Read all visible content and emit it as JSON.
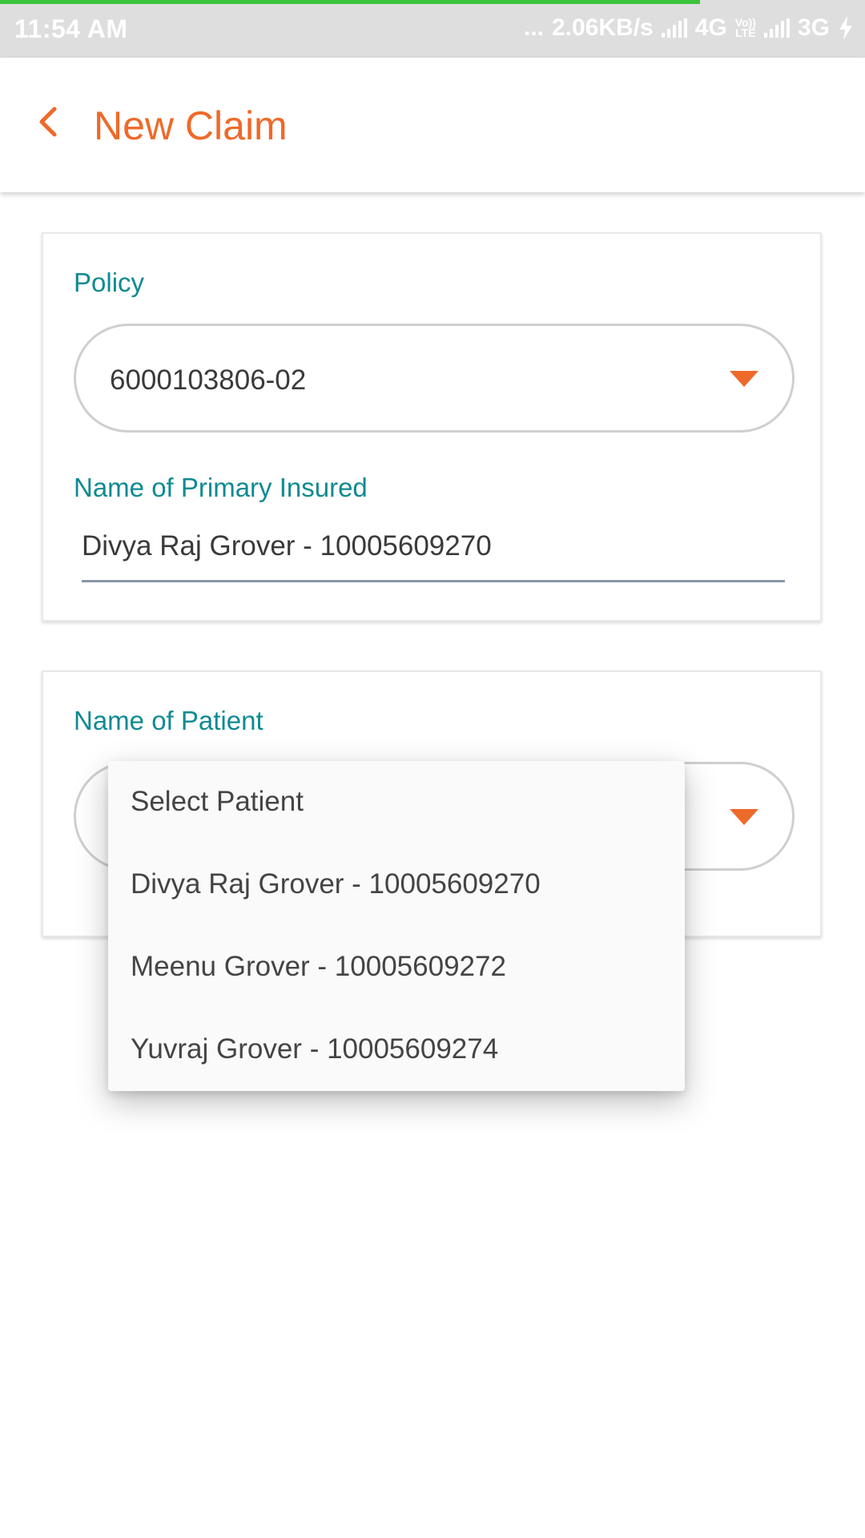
{
  "status_bar": {
    "time": "11:54 AM",
    "dots": "...",
    "speed": "2.06KB/s",
    "network1": "4G",
    "volte_line1": "Vo))",
    "volte_line2": "LTE",
    "network2": "3G"
  },
  "header": {
    "title": "New Claim"
  },
  "policy_card": {
    "policy_label": "Policy",
    "policy_value": "6000103806-02",
    "insured_label": "Name of Primary Insured",
    "insured_value": "Divya Raj Grover - 10005609270"
  },
  "patient_card": {
    "patient_label": "Name of Patient"
  },
  "patient_dropdown": {
    "options": [
      "Select Patient",
      "Divya Raj Grover - 10005609270",
      "Meenu Grover - 10005609272",
      "Yuvraj Grover - 10005609274"
    ]
  },
  "colors": {
    "accent": "#ee6a2a",
    "label": "#0f8a92",
    "status_bar": "#dedede"
  }
}
